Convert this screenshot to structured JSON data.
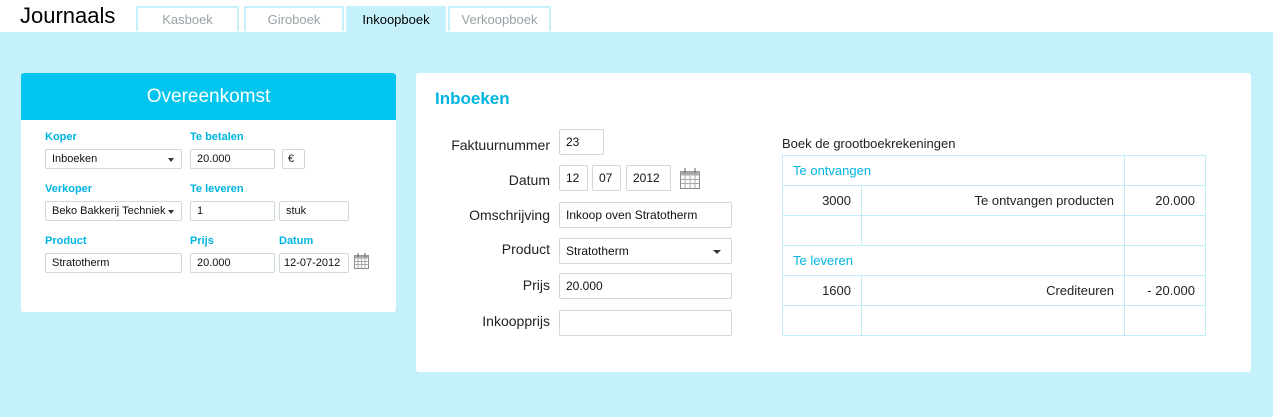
{
  "app": {
    "title": "Journaals"
  },
  "tabs": [
    {
      "label": "Kasboek",
      "active": false
    },
    {
      "label": "Giroboek",
      "active": false
    },
    {
      "label": "Inkoopboek",
      "active": true
    },
    {
      "label": "Verkoopboek",
      "active": false
    }
  ],
  "overeenkomst": {
    "title": "Overeenkomst",
    "koper": {
      "label": "Koper",
      "value": "Inboeken"
    },
    "te_betalen": {
      "label": "Te betalen",
      "value": "20.000",
      "currency": "€"
    },
    "verkoper": {
      "label": "Verkoper",
      "value": "Beko Bakkerij Techniek"
    },
    "te_leveren": {
      "label": "Te leveren",
      "value": "1",
      "unit": "stuk"
    },
    "product": {
      "label": "Product",
      "value": "Stratotherm"
    },
    "prijs": {
      "label": "Prijs",
      "value": "20.000"
    },
    "datum": {
      "label": "Datum",
      "value": "12-07-2012"
    }
  },
  "inboeken": {
    "title": "Inboeken",
    "faktuurnummer": {
      "label": "Faktuurnummer",
      "value": "23"
    },
    "datum": {
      "label": "Datum",
      "day": "12",
      "month": "07",
      "year": "2012"
    },
    "omschrijving": {
      "label": "Omschrijving",
      "value": "Inkoop oven Stratotherm"
    },
    "product": {
      "label": "Product",
      "value": "Stratotherm"
    },
    "prijs": {
      "label": "Prijs",
      "value": "20.000"
    },
    "inkoopprijs": {
      "label": "Inkoopprijs",
      "value": ""
    }
  },
  "ledger": {
    "title": "Boek de grootboekrekeningen",
    "te_ontvangen": {
      "header": "Te ontvangen",
      "account": "3000",
      "description": "Te ontvangen producten",
      "amount": "20.000"
    },
    "te_leveren": {
      "header": "Te leveren",
      "account": "1600",
      "description": "Crediteuren",
      "amount": "- 20.000"
    }
  },
  "colors": {
    "accent": "#00c5ee",
    "stage": "#c5f1fa",
    "label": "#00b4e2"
  },
  "icons": {
    "calendar": "calendar-icon",
    "dropdown": "chevron-down-icon"
  }
}
